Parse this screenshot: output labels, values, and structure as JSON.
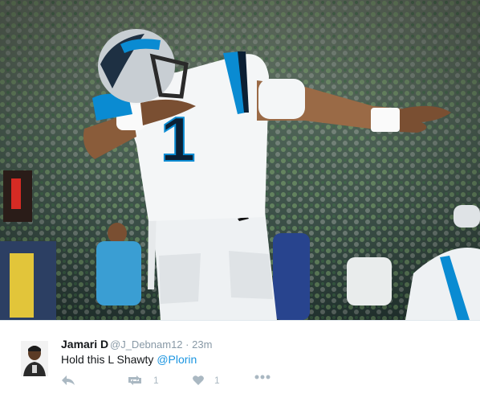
{
  "tweet": {
    "display_name": "Jamari D",
    "handle": "@J_Debnam12",
    "separator": "·",
    "time": "23m",
    "text_prefix": "Hold this L Shawty ",
    "mention": "@Plorin"
  },
  "actions": {
    "reply_icon": "reply-icon",
    "retweet_icon": "retweet-icon",
    "retweet_count": "1",
    "like_icon": "heart-icon",
    "like_count": "1",
    "more_icon": "more-icon"
  },
  "photo": {
    "jersey_number": "1",
    "colors": {
      "jersey": "#f4f6f7",
      "accent": "#0a8bd2",
      "dark": "#0b1f33"
    }
  }
}
